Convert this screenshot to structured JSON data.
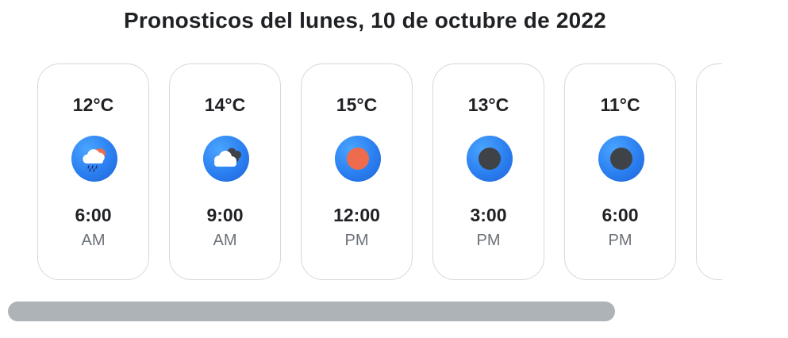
{
  "page": {
    "title": "Pronosticos del lunes, 10 de octubre de 2022"
  },
  "forecasts": [
    {
      "temp": "12°C",
      "time": "6:00",
      "period": "AM",
      "icon": "rain-cloud-sun-icon"
    },
    {
      "temp": "14°C",
      "time": "9:00",
      "period": "AM",
      "icon": "cloudy-icon"
    },
    {
      "temp": "15°C",
      "time": "12:00",
      "period": "PM",
      "icon": "sun-icon"
    },
    {
      "temp": "13°C",
      "time": "3:00",
      "period": "PM",
      "icon": "moon-icon"
    },
    {
      "temp": "11°C",
      "time": "6:00",
      "period": "PM",
      "icon": "moon-icon"
    },
    {
      "temp": "",
      "time": "",
      "period": "",
      "icon": ""
    }
  ],
  "colors": {
    "icon_blue": "#2b7ff0",
    "sun": "#ee6c4d",
    "moon": "#3f4348",
    "scrollbar": "#aeb3b8",
    "card_border": "#d6d8db"
  },
  "scrollbar": {
    "visible_fraction": 0.85
  }
}
